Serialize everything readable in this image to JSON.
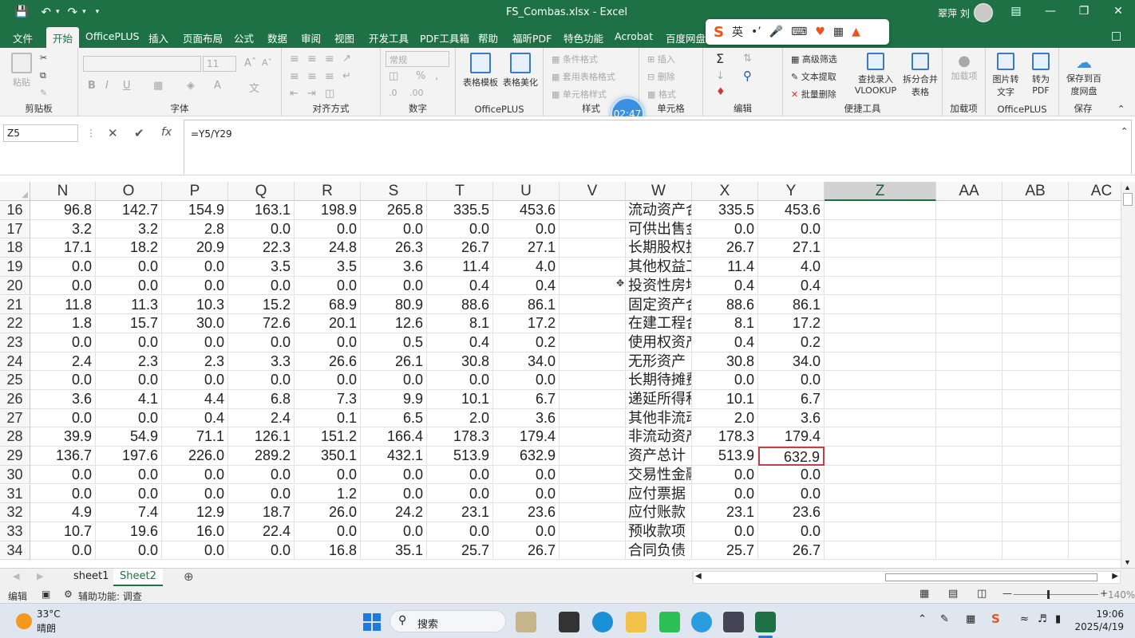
{
  "window": {
    "title": "FS_Combas.xlsx  -  Excel",
    "user": "翠萍 刘"
  },
  "menu": {
    "tabs": [
      "文件",
      "开始",
      "OfficePLUS",
      "插入",
      "页面布局",
      "公式",
      "数据",
      "审阅",
      "视图",
      "开发工具",
      "PDF工具箱",
      "帮助",
      "福昕PDF",
      "特色功能",
      "Acrobat",
      "百度网盘"
    ],
    "active": "开始"
  },
  "ime": {
    "mode": "英"
  },
  "ribbon": {
    "clipboard": {
      "label": "剪贴板",
      "paste": "粘贴"
    },
    "font": {
      "label": "字体",
      "size": "11"
    },
    "align": {
      "label": "对齐方式"
    },
    "number": {
      "label": "数字",
      "format": "常规"
    },
    "officeplus": {
      "label": "OfficePLUS",
      "tpl": "表格模板",
      "beautify": "表格美化"
    },
    "style": {
      "label": "样式",
      "cond": "条件格式",
      "table": "套用表格格式",
      "cell": "单元格样式"
    },
    "cells": {
      "label": "单元格",
      "insert": "插入",
      "delete": "删除",
      "format": "格式"
    },
    "edit": {
      "label": "编辑"
    },
    "tools": {
      "label": "便捷工具",
      "filter": "高级筛选",
      "extract": "文本提取",
      "batchdel": "批量删除",
      "vlookup": "查找录入VLOOKUP",
      "split": "拆分合并表格"
    },
    "addin": {
      "label": "加载项",
      "btn": "加载项"
    },
    "officeplus2": {
      "label": "OfficePLUS",
      "img2txt": "图片转文字",
      "topdf": "转为PDF"
    },
    "save": {
      "label": "保存",
      "btn": "保存到百度网盘"
    },
    "timer": "02:47"
  },
  "formulabar": {
    "namebox": "Z5",
    "formula": "=Y5/Y29"
  },
  "columns": [
    "N",
    "O",
    "P",
    "Q",
    "R",
    "S",
    "T",
    "U",
    "V",
    "W",
    "X",
    "Y",
    "Z",
    "AA",
    "AB",
    "AC"
  ],
  "rows": [
    {
      "n": "16",
      "v": [
        "96.8",
        "142.7",
        "154.9",
        "163.1",
        "198.9",
        "265.8",
        "335.5",
        "453.6",
        "",
        "流动资产合计",
        "335.5",
        "453.6"
      ]
    },
    {
      "n": "17",
      "v": [
        "3.2",
        "3.2",
        "2.8",
        "0.0",
        "0.0",
        "0.0",
        "0.0",
        "0.0",
        "",
        "可供出售金融资产",
        "0.0",
        "0.0"
      ]
    },
    {
      "n": "18",
      "v": [
        "17.1",
        "18.2",
        "20.9",
        "22.3",
        "24.8",
        "26.3",
        "26.7",
        "27.1",
        "",
        "长期股权投资",
        "26.7",
        "27.1"
      ]
    },
    {
      "n": "19",
      "v": [
        "0.0",
        "0.0",
        "0.0",
        "3.5",
        "3.5",
        "3.6",
        "11.4",
        "4.0",
        "",
        "其他权益工具投资",
        "11.4",
        "4.0"
      ]
    },
    {
      "n": "20",
      "v": [
        "0.0",
        "0.0",
        "0.0",
        "0.0",
        "0.0",
        "0.0",
        "0.4",
        "0.4",
        "",
        "投资性房地产",
        "0.4",
        "0.4"
      ]
    },
    {
      "n": "21",
      "v": [
        "11.8",
        "11.3",
        "10.3",
        "15.2",
        "68.9",
        "80.9",
        "88.6",
        "86.1",
        "",
        "固定资产合计",
        "88.6",
        "86.1"
      ]
    },
    {
      "n": "22",
      "v": [
        "1.8",
        "15.7",
        "30.0",
        "72.6",
        "20.1",
        "12.6",
        "8.1",
        "17.2",
        "",
        "在建工程合计",
        "8.1",
        "17.2"
      ]
    },
    {
      "n": "23",
      "v": [
        "0.0",
        "0.0",
        "0.0",
        "0.0",
        "0.0",
        "0.5",
        "0.4",
        "0.2",
        "",
        "使用权资产",
        "0.4",
        "0.2"
      ]
    },
    {
      "n": "24",
      "v": [
        "2.4",
        "2.3",
        "2.3",
        "3.3",
        "26.6",
        "26.1",
        "30.8",
        "34.0",
        "",
        "无形资产",
        "30.8",
        "34.0"
      ]
    },
    {
      "n": "25",
      "v": [
        "0.0",
        "0.0",
        "0.0",
        "0.0",
        "0.0",
        "0.0",
        "0.0",
        "0.0",
        "",
        "长期待摊费用",
        "0.0",
        "0.0"
      ]
    },
    {
      "n": "26",
      "v": [
        "3.6",
        "4.1",
        "4.4",
        "6.8",
        "7.3",
        "9.9",
        "10.1",
        "6.7",
        "",
        "递延所得税资产",
        "10.1",
        "6.7"
      ]
    },
    {
      "n": "27",
      "v": [
        "0.0",
        "0.0",
        "0.4",
        "2.4",
        "0.1",
        "6.5",
        "2.0",
        "3.6",
        "",
        "其他非流动资产",
        "2.0",
        "3.6"
      ]
    },
    {
      "n": "28",
      "v": [
        "39.9",
        "54.9",
        "71.1",
        "126.1",
        "151.2",
        "166.4",
        "178.3",
        "179.4",
        "",
        "非流动资产合计",
        "178.3",
        "179.4"
      ]
    },
    {
      "n": "29",
      "v": [
        "136.7",
        "197.6",
        "226.0",
        "289.2",
        "350.1",
        "432.1",
        "513.9",
        "632.9",
        "",
        "资产总计",
        "513.9",
        "632.9"
      ]
    },
    {
      "n": "30",
      "v": [
        "0.0",
        "0.0",
        "0.0",
        "0.0",
        "0.0",
        "0.0",
        "0.0",
        "0.0",
        "",
        "交易性金融负债",
        "0.0",
        "0.0"
      ]
    },
    {
      "n": "31",
      "v": [
        "0.0",
        "0.0",
        "0.0",
        "0.0",
        "1.2",
        "0.0",
        "0.0",
        "0.0",
        "",
        "应付票据",
        "0.0",
        "0.0"
      ]
    },
    {
      "n": "32",
      "v": [
        "4.9",
        "7.4",
        "12.9",
        "18.7",
        "26.0",
        "24.2",
        "23.1",
        "23.6",
        "",
        "应付账款",
        "23.1",
        "23.6"
      ]
    },
    {
      "n": "33",
      "v": [
        "10.7",
        "19.6",
        "16.0",
        "22.4",
        "0.0",
        "0.0",
        "0.0",
        "0.0",
        "",
        "预收款项",
        "0.0",
        "0.0"
      ]
    },
    {
      "n": "34",
      "v": [
        "0.0",
        "0.0",
        "0.0",
        "0.0",
        "16.8",
        "35.1",
        "25.7",
        "26.7",
        "",
        "合同负债",
        "25.7",
        "26.7"
      ]
    }
  ],
  "sheets": {
    "tabs": [
      "sheet1",
      "Sheet2"
    ],
    "active": "Sheet2"
  },
  "status": {
    "mode": "编辑",
    "accessibility": "辅助功能: 调查",
    "zoom": "140%"
  },
  "taskbar": {
    "temp": "33°C",
    "weather": "晴朗",
    "search": "搜索",
    "time": "19:06",
    "date": "2025/4/19"
  }
}
